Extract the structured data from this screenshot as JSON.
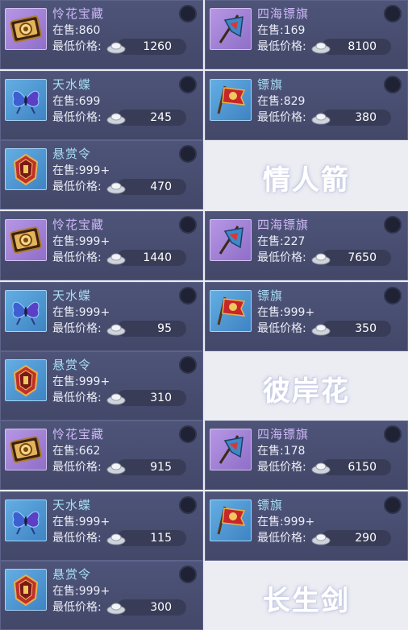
{
  "labels": {
    "stock_prefix": "在售:",
    "price_label": "最低价格:"
  },
  "groups": [
    {
      "server": "情人箭",
      "items": [
        {
          "name": "怜花宝藏",
          "stock": "860",
          "price": "1260",
          "icon": "treasure-chest-icon",
          "rarity": "purple"
        },
        {
          "name": "四海镖旗",
          "stock": "169",
          "price": "8100",
          "icon": "escort-flag-icon",
          "rarity": "purple"
        },
        {
          "name": "天水蝶",
          "stock": "699",
          "price": "245",
          "icon": "butterfly-icon",
          "rarity": "blue"
        },
        {
          "name": "镖旗",
          "stock": "829",
          "price": "380",
          "icon": "red-flag-icon",
          "rarity": "blue"
        },
        {
          "name": "悬赏令",
          "stock": "999+",
          "price": "470",
          "icon": "bounty-order-icon",
          "rarity": "blue"
        }
      ]
    },
    {
      "server": "彼岸花",
      "items": [
        {
          "name": "怜花宝藏",
          "stock": "999+",
          "price": "1440",
          "icon": "treasure-chest-icon",
          "rarity": "purple"
        },
        {
          "name": "四海镖旗",
          "stock": "227",
          "price": "7650",
          "icon": "escort-flag-icon",
          "rarity": "purple"
        },
        {
          "name": "天水蝶",
          "stock": "999+",
          "price": "95",
          "icon": "butterfly-icon",
          "rarity": "blue"
        },
        {
          "name": "镖旗",
          "stock": "999+",
          "price": "350",
          "icon": "red-flag-icon",
          "rarity": "blue"
        },
        {
          "name": "悬赏令",
          "stock": "999+",
          "price": "310",
          "icon": "bounty-order-icon",
          "rarity": "blue"
        }
      ]
    },
    {
      "server": "长生剑",
      "items": [
        {
          "name": "怜花宝藏",
          "stock": "662",
          "price": "915",
          "icon": "treasure-chest-icon",
          "rarity": "purple"
        },
        {
          "name": "四海镖旗",
          "stock": "178",
          "price": "6150",
          "icon": "escort-flag-icon",
          "rarity": "purple"
        },
        {
          "name": "天水蝶",
          "stock": "999+",
          "price": "115",
          "icon": "butterfly-icon",
          "rarity": "blue"
        },
        {
          "name": "镖旗",
          "stock": "999+",
          "price": "290",
          "icon": "red-flag-icon",
          "rarity": "blue"
        },
        {
          "name": "悬赏令",
          "stock": "999+",
          "price": "300",
          "icon": "bounty-order-icon",
          "rarity": "blue"
        }
      ]
    }
  ]
}
